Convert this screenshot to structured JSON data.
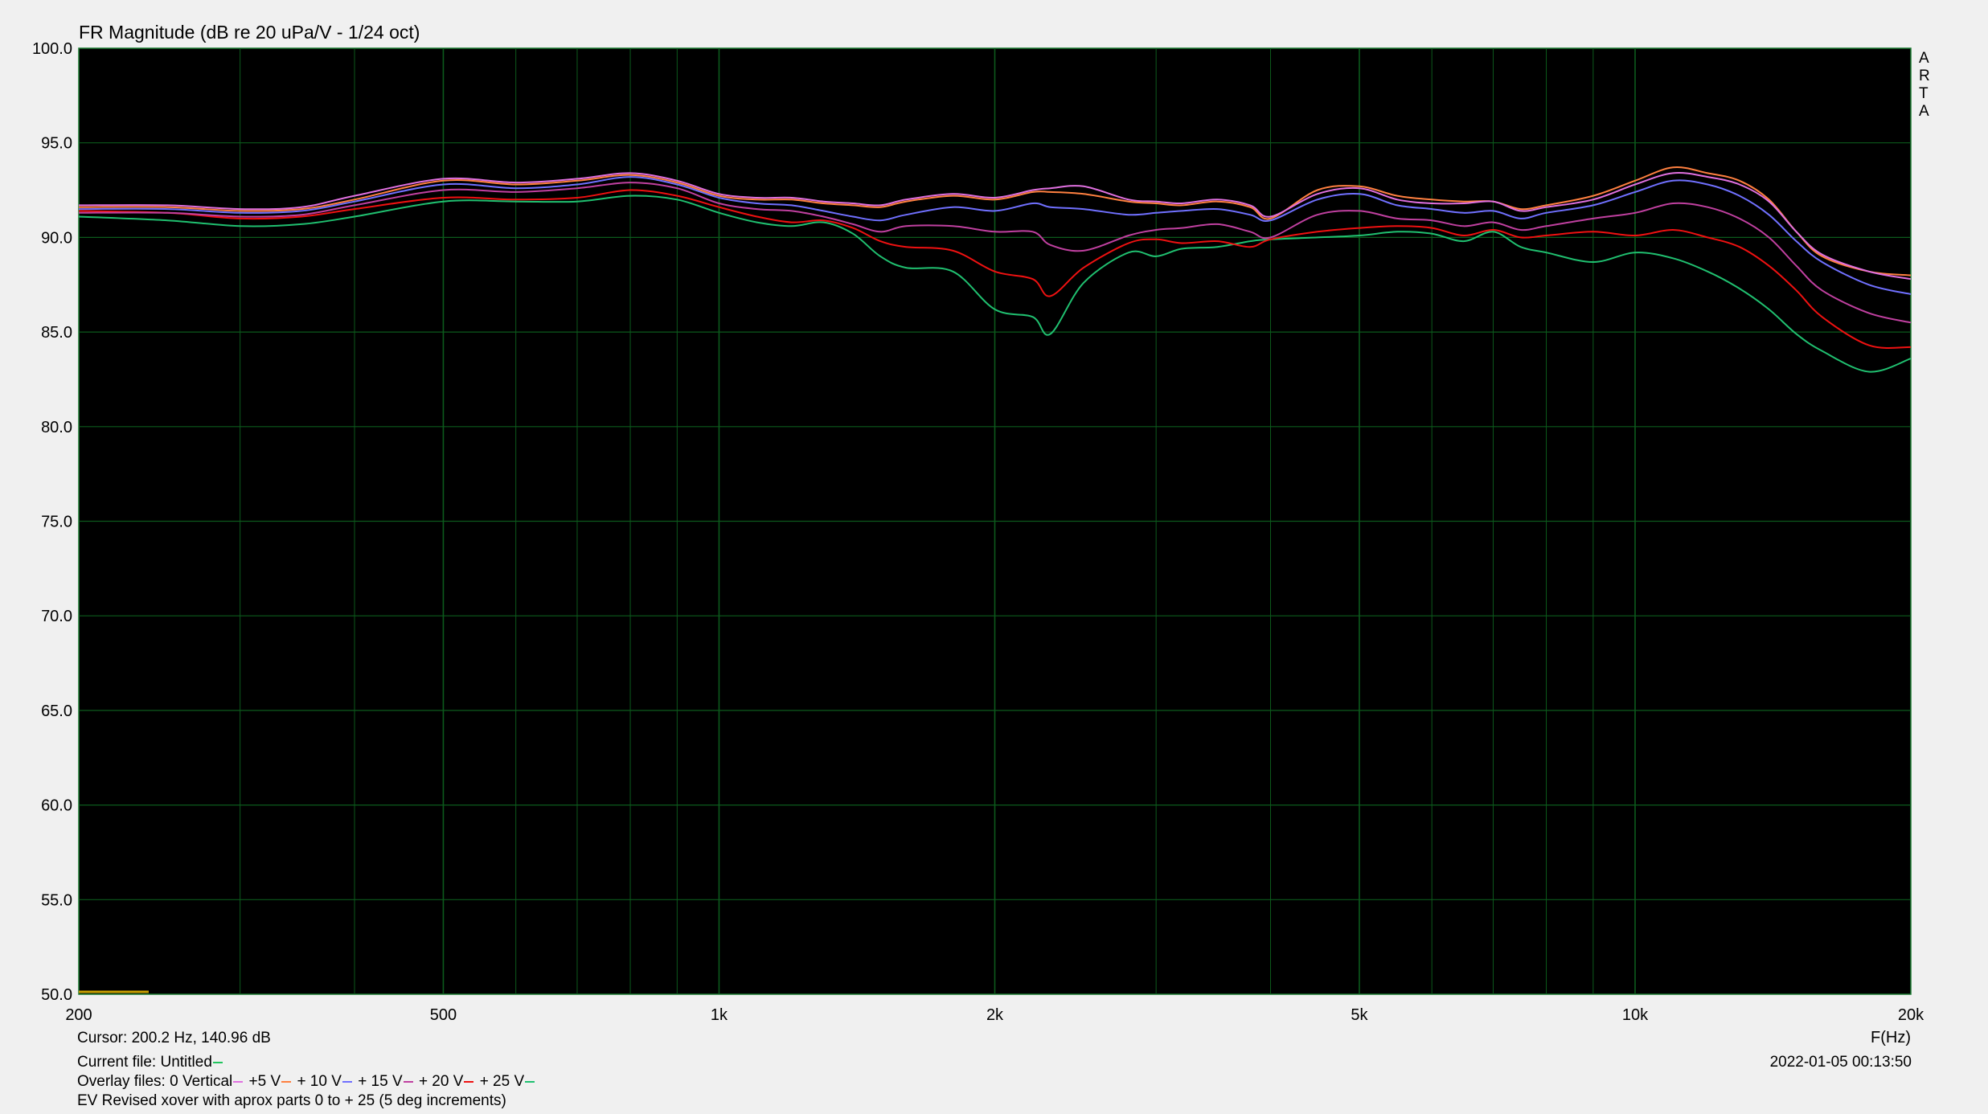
{
  "window": {
    "title": "FR Magnitude (dB re 20 uPa/V - 1/24 oct)",
    "watermark": [
      "A",
      "R",
      "T",
      "A"
    ],
    "x_unit_label": "F(Hz)"
  },
  "footer": {
    "cursor": "Cursor: 200.2 Hz, 140.96 dB",
    "current_file_label": "Current file: Untitled",
    "current_file_color": "#22c55e",
    "overlay_prefix": "Overlay files:",
    "overlays": [
      {
        "label": "0 Vertical",
        "color": "#e070e0"
      },
      {
        "label": "+5 V",
        "color": "#ff8040"
      },
      {
        "label": "+ 10 V",
        "color": "#7070ff"
      },
      {
        "label": "+ 15 V",
        "color": "#c040a0"
      },
      {
        "label": "+ 20 V",
        "color": "#ee1111"
      },
      {
        "label": "+ 25 V",
        "color": "#20c070"
      }
    ],
    "description": "EV Revised xover with aprox parts 0 to + 25 (5 deg increments)",
    "timestamp": "2022-01-05  00:13:50"
  },
  "chart_data": {
    "type": "line",
    "title": "FR Magnitude (dB re 20 uPa/V - 1/24 oct)",
    "xlabel": "F(Hz)",
    "ylabel": "",
    "x_scale": "log",
    "xlim": [
      200,
      20000
    ],
    "ylim": [
      50,
      100
    ],
    "x_ticks": [
      200,
      500,
      1000,
      2000,
      5000,
      10000,
      20000
    ],
    "x_tick_labels": [
      "200",
      "500",
      "1k",
      "2k",
      "5k",
      "10k",
      "20k"
    ],
    "y_ticks": [
      50,
      55,
      60,
      65,
      70,
      75,
      80,
      85,
      90,
      95,
      100
    ],
    "y_tick_labels": [
      "50.0",
      "55.0",
      "60.0",
      "65.0",
      "70.0",
      "75.0",
      "80.0",
      "85.0",
      "90.0",
      "95.0",
      "100.0"
    ],
    "grid": true,
    "background": "#000000",
    "grid_color": "#0c5a1c",
    "x": [
      200,
      250,
      300,
      350,
      400,
      500,
      600,
      700,
      800,
      900,
      1000,
      1100,
      1200,
      1300,
      1400,
      1500,
      1600,
      1800,
      2000,
      2200,
      2300,
      2500,
      2800,
      3000,
      3200,
      3500,
      3800,
      4000,
      4500,
      5000,
      5500,
      6000,
      6500,
      7000,
      7500,
      8000,
      9000,
      10000,
      11000,
      12000,
      13000,
      14000,
      15000,
      16000,
      18000,
      20000
    ],
    "series": [
      {
        "name": "0 Vertical",
        "color": "#e070e0",
        "values": [
          91.7,
          91.7,
          91.5,
          91.6,
          92.2,
          93.1,
          92.9,
          93.1,
          93.4,
          93.0,
          92.3,
          92.1,
          92.1,
          91.9,
          91.8,
          91.7,
          92.0,
          92.3,
          92.1,
          92.5,
          92.6,
          92.7,
          92.0,
          91.9,
          91.8,
          92.0,
          91.7,
          91.1,
          92.3,
          92.6,
          92.0,
          91.8,
          91.8,
          91.9,
          91.4,
          91.6,
          92.0,
          92.8,
          93.4,
          93.2,
          92.8,
          91.9,
          90.3,
          89.1,
          88.2,
          87.8
        ]
      },
      {
        "name": "+5 V",
        "color": "#ff8040",
        "values": [
          91.6,
          91.6,
          91.4,
          91.5,
          92.0,
          93.0,
          92.8,
          93.0,
          93.3,
          92.9,
          92.2,
          92.0,
          92.0,
          91.8,
          91.7,
          91.6,
          91.9,
          92.2,
          92.0,
          92.4,
          92.4,
          92.3,
          91.9,
          91.8,
          91.7,
          91.9,
          91.6,
          91.0,
          92.5,
          92.7,
          92.2,
          92.0,
          91.9,
          91.9,
          91.5,
          91.7,
          92.2,
          93.0,
          93.7,
          93.4,
          93.0,
          92.0,
          90.3,
          89.0,
          88.2,
          88.0
        ]
      },
      {
        "name": "+ 10 V",
        "color": "#7070ff",
        "values": [
          91.5,
          91.5,
          91.3,
          91.4,
          91.9,
          92.8,
          92.6,
          92.8,
          93.2,
          92.8,
          92.1,
          91.8,
          91.7,
          91.4,
          91.1,
          90.9,
          91.2,
          91.6,
          91.4,
          91.8,
          91.6,
          91.5,
          91.2,
          91.3,
          91.4,
          91.5,
          91.2,
          90.9,
          92.0,
          92.3,
          91.7,
          91.5,
          91.3,
          91.4,
          91.0,
          91.3,
          91.7,
          92.4,
          93.0,
          92.8,
          92.2,
          91.2,
          89.8,
          88.7,
          87.5,
          87.0
        ]
      },
      {
        "name": "+ 15 V",
        "color": "#c040a0",
        "values": [
          91.3,
          91.3,
          91.1,
          91.2,
          91.7,
          92.5,
          92.4,
          92.6,
          92.9,
          92.6,
          91.8,
          91.5,
          91.4,
          91.1,
          90.7,
          90.3,
          90.6,
          90.6,
          90.3,
          90.3,
          89.6,
          89.3,
          90.1,
          90.4,
          90.5,
          90.7,
          90.3,
          90.0,
          91.2,
          91.4,
          91.0,
          90.9,
          90.6,
          90.8,
          90.4,
          90.6,
          91.0,
          91.3,
          91.8,
          91.6,
          91.0,
          90.0,
          88.5,
          87.2,
          86.0,
          85.5
        ]
      },
      {
        "name": "+ 20 V",
        "color": "#ee1111",
        "values": [
          91.4,
          91.3,
          91.0,
          91.1,
          91.5,
          92.1,
          92.0,
          92.1,
          92.5,
          92.2,
          91.6,
          91.1,
          90.8,
          90.9,
          90.5,
          89.8,
          89.5,
          89.3,
          88.2,
          87.8,
          86.9,
          88.4,
          89.7,
          89.9,
          89.7,
          89.8,
          89.5,
          89.9,
          90.3,
          90.5,
          90.6,
          90.5,
          90.1,
          90.4,
          90.0,
          90.1,
          90.3,
          90.1,
          90.4,
          90.0,
          89.5,
          88.5,
          87.2,
          85.8,
          84.3,
          84.2
        ]
      },
      {
        "name": "+ 25 V",
        "color": "#20c070",
        "values": [
          91.1,
          90.9,
          90.6,
          90.7,
          91.1,
          91.9,
          91.9,
          91.9,
          92.2,
          92.0,
          91.3,
          90.8,
          90.6,
          90.8,
          90.2,
          89.0,
          88.4,
          88.2,
          86.2,
          85.8,
          84.9,
          87.6,
          89.2,
          89.0,
          89.4,
          89.5,
          89.8,
          89.9,
          90.0,
          90.1,
          90.3,
          90.2,
          89.8,
          90.3,
          89.5,
          89.2,
          88.7,
          89.2,
          88.9,
          88.2,
          87.3,
          86.2,
          84.9,
          84.0,
          82.9,
          83.6
        ]
      }
    ]
  }
}
